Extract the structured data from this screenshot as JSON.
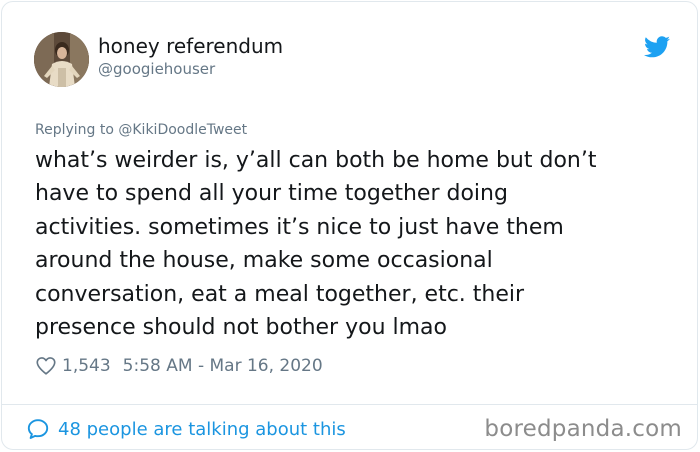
{
  "tweet": {
    "author_name": "honey referendum",
    "author_handle": "@googiehouser",
    "replying_to": "Replying to @KikiDoodleTweet",
    "lines": [
      "what’s weirder is, y’all can both be home but don’t",
      "have to spend all your time together doing",
      "activities. sometimes it’s nice to just have them",
      "around the house, make some occasional",
      "conversation, eat a meal together, etc. their",
      "presence should not bother you lmao"
    ],
    "likes": "1,543",
    "timestamp": "5:58 AM - Mar 16, 2020",
    "talking": "48 people are talking about this"
  },
  "watermark": "boredpanda.com",
  "icons": {
    "brand": "twitter-bird-icon",
    "like": "heart-icon",
    "conversation": "speech-bubble-icon"
  },
  "colors": {
    "twitter_blue": "#1da1f2",
    "link_blue": "#1b95e0",
    "secondary_text": "#657786",
    "primary_text": "#14171a",
    "border": "#e1e8ed",
    "watermark": "#8c8c8c"
  }
}
